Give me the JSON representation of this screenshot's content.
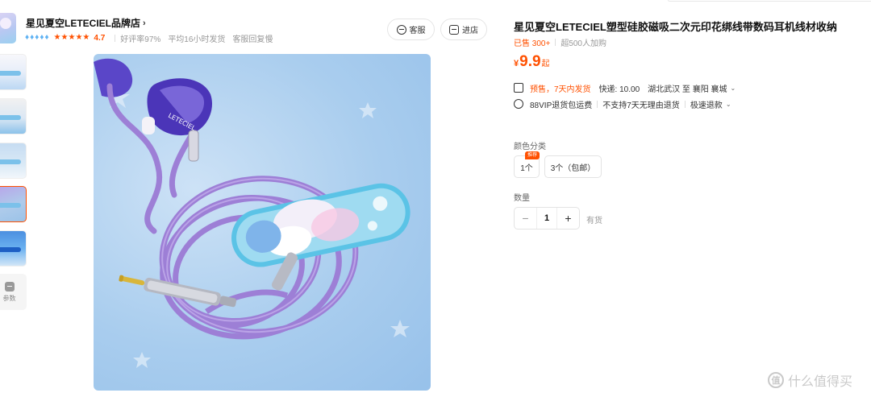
{
  "store": {
    "name": "星见夏空LETECIEL品牌店",
    "chevron": "›",
    "diamonds": [
      "♦",
      "♦",
      "♦",
      "♦",
      "♦"
    ],
    "stars": [
      "★",
      "★",
      "★",
      "★",
      "★"
    ],
    "rating": "4.7",
    "meta": [
      "好评率97%",
      "平均16小时发货",
      "客服回复慢"
    ]
  },
  "header_buttons": {
    "service": "客服",
    "enter_store": "进店"
  },
  "thumbnails": {
    "param_label": "参数"
  },
  "product": {
    "title": "星见夏空LETECIEL塑型硅胶磁吸二次元印花绑线带数码耳机线材收纳",
    "sold": "已售 300+",
    "cart": "超500人加购",
    "price_currency": "¥",
    "price_value": "9.9",
    "price_suffix": "起"
  },
  "shipping": {
    "presale": "预售，7天内发货",
    "express": "快递: 10.00",
    "route": "湖北武汉 至 襄阳 襄城",
    "vip": "88VIP退货包运费",
    "no_return": "不支持7天无理由退货",
    "refund": "极速退款",
    "arrow": "⌄"
  },
  "options": {
    "color_label": "颜色分类",
    "items": [
      "1个",
      "3个（包邮）"
    ],
    "badge": "推荐"
  },
  "quantity": {
    "label": "数量",
    "minus": "−",
    "value": "1",
    "plus": "+",
    "stock": "有货"
  },
  "watermark": {
    "icon": "值",
    "text": "什么值得买"
  },
  "image_text": {
    "brand_print": "LETECIEL"
  },
  "colors": {
    "accent": "#ff5000",
    "diamond": "#5fb2f3",
    "cable": "#9d7fd6"
  }
}
